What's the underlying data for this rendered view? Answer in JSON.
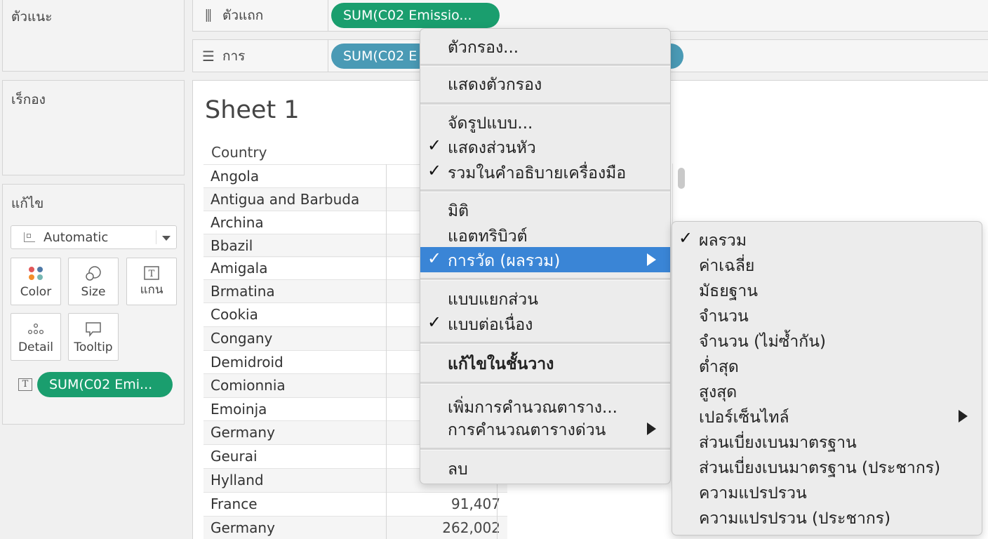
{
  "panels": {
    "pages_title": "ตัวแนะ",
    "filters_title": "เร็กอง",
    "marks_title": "แก้ไข",
    "mark_type": "Automatic",
    "mark_buttons": [
      "Color",
      "Size",
      "แกน",
      "Detail",
      "Tooltip"
    ],
    "marks_pill": "SUM(C02 Emi..."
  },
  "shelves": {
    "columns_label": "ตัวแถก",
    "columns_pill": "SUM(C02 Emissio...",
    "rows_label": "การ",
    "rows_pill": "SUM(C02 E"
  },
  "sheet": {
    "title": "Sheet 1",
    "column_header": "Country",
    "rows": [
      {
        "country": "Angola",
        "value": ""
      },
      {
        "country": "Antigua and Barbuda",
        "value": ""
      },
      {
        "country": "Archina",
        "value": ""
      },
      {
        "country": "Bbazil",
        "value": ""
      },
      {
        "country": "Amigala",
        "value": ""
      },
      {
        "country": "Brmatina",
        "value": ""
      },
      {
        "country": "Cookia",
        "value": ""
      },
      {
        "country": "Congany",
        "value": ""
      },
      {
        "country": "Demidroid",
        "value": ""
      },
      {
        "country": "Comionnia",
        "value": ""
      },
      {
        "country": "Emoinja",
        "value": ""
      },
      {
        "country": "Germany",
        "value": ""
      },
      {
        "country": "Geurai",
        "value": ""
      },
      {
        "country": "Hylland",
        "value": ""
      },
      {
        "country": "France",
        "value": "91,407"
      },
      {
        "country": "Germany",
        "value": "262,002"
      }
    ]
  },
  "context_menu": {
    "items": [
      {
        "label": "ตัวกรอง...",
        "checked": false,
        "submenu": false
      },
      {
        "label": "แสดงตัวกรอง",
        "checked": false,
        "submenu": false
      },
      {
        "label": "จัดรูปแบบ...",
        "checked": false,
        "submenu": false
      },
      {
        "label": "แสดงส่วนหัว",
        "checked": true,
        "submenu": false
      },
      {
        "label": "รวมในคำอธิบายเครื่องมือ",
        "checked": true,
        "submenu": false
      },
      {
        "label": "มิติ",
        "checked": false,
        "submenu": false
      },
      {
        "label": "แอตทริบิวต์",
        "checked": false,
        "submenu": false
      },
      {
        "label": "การวัด (ผลรวม)",
        "checked": true,
        "submenu": true,
        "active": true
      },
      {
        "label": "แบบแยกส่วน",
        "checked": false,
        "submenu": false
      },
      {
        "label": "แบบต่อเนื่อง",
        "checked": true,
        "submenu": false
      },
      {
        "label": "แก้ไขในชั้นวาง",
        "checked": false,
        "submenu": false,
        "bold": true
      },
      {
        "label": "เพิ่มการคำนวณตาราง...",
        "checked": false,
        "submenu": false
      },
      {
        "label": "การคำนวณตารางด่วน",
        "checked": false,
        "submenu": true
      },
      {
        "label": "ลบ",
        "checked": false,
        "submenu": false
      }
    ],
    "check_glyph": "✓"
  },
  "measure_submenu": {
    "items": [
      {
        "label": "ผลรวม",
        "checked": true,
        "submenu": false
      },
      {
        "label": "ค่าเฉลี่ย",
        "checked": false,
        "submenu": false
      },
      {
        "label": "มัธยฐาน",
        "checked": false,
        "submenu": false
      },
      {
        "label": "จำนวน",
        "checked": false,
        "submenu": false
      },
      {
        "label": "จำนวน (ไม่ซ้ำกัน)",
        "checked": false,
        "submenu": false
      },
      {
        "label": "ต่ำสุด",
        "checked": false,
        "submenu": false
      },
      {
        "label": "สูงสุด",
        "checked": false,
        "submenu": false
      },
      {
        "label": "เปอร์เซ็นไทล์",
        "checked": false,
        "submenu": true
      },
      {
        "label": "ส่วนเบี่ยงเบนมาตรฐาน",
        "checked": false,
        "submenu": false
      },
      {
        "label": "ส่วนเบี่ยงเบนมาตรฐาน (ประชากร)",
        "checked": false,
        "submenu": false
      },
      {
        "label": "ความแปรปรวน",
        "checked": false,
        "submenu": false
      },
      {
        "label": "ความแปรปรวน (ประชากร)",
        "checked": false,
        "submenu": false
      }
    ]
  },
  "colors": {
    "pill_green": "#1a9e6e",
    "pill_blue": "#4a9ab5",
    "menu_highlight": "#3a85d6"
  }
}
